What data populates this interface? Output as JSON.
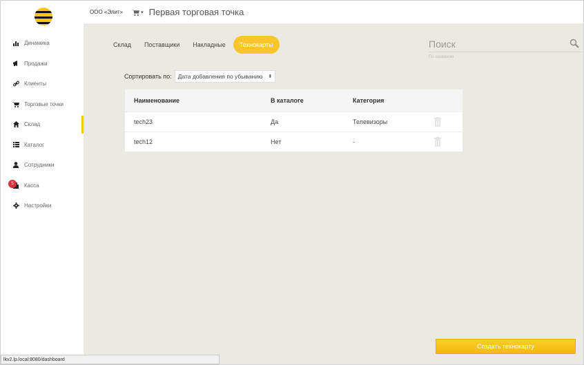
{
  "topbar": {
    "org_name": "ООО «Элит»",
    "store_name": "Первая торговая точка"
  },
  "sidebar": {
    "items": [
      {
        "label": "Динамика",
        "icon": "bar-chart-icon"
      },
      {
        "label": "Продажи",
        "icon": "megaphone-icon"
      },
      {
        "label": "Клиенты",
        "icon": "link-icon"
      },
      {
        "label": "Торговые точки",
        "icon": "cart-icon"
      },
      {
        "label": "Склад",
        "icon": "home-icon",
        "active": true
      },
      {
        "label": "Каталог",
        "icon": "list-icon"
      },
      {
        "label": "Сотрудники",
        "icon": "user-icon"
      },
      {
        "label": "Касса",
        "icon": "register-icon",
        "badge": "5"
      },
      {
        "label": "Настройки",
        "icon": "gear-icon"
      }
    ]
  },
  "tabs": [
    {
      "label": "Склад"
    },
    {
      "label": "Поставщики"
    },
    {
      "label": "Накладные"
    },
    {
      "label": "Технокарты",
      "active": true
    }
  ],
  "search": {
    "placeholder": "Поиск",
    "hint": "По названию"
  },
  "sort": {
    "label": "Сортировать по:",
    "value": "Дата добавления по убыванию"
  },
  "table": {
    "headers": [
      "Наименование",
      "В каталоге",
      "Категория"
    ],
    "rows": [
      {
        "name": "tech23",
        "in_catalog": "Да",
        "category": "Телевизоры"
      },
      {
        "name": "tech12",
        "in_catalog": "Нет",
        "category": "-"
      }
    ]
  },
  "create_button": "Создать технокарту",
  "status_url": "lkv2.lp.local:8080/dashboard",
  "colors": {
    "accent": "#f8c52b",
    "badge": "#d9343f",
    "background": "#ebe9e4"
  }
}
